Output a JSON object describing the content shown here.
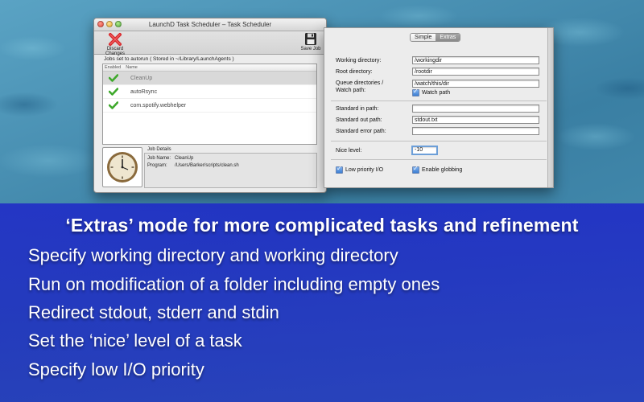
{
  "main_window": {
    "title": "LaunchD Task Scheduler – Task Scheduler",
    "toolbar": {
      "discard_label": "Discard Changes",
      "discard_icon": "red-x-icon",
      "save_label": "Save Job",
      "save_icon": "floppy-disk-icon"
    },
    "jobs_label": "Jobs set to autorun ( Stored in ~/Library/LaunchAgents )",
    "columns": [
      "Enabled",
      "Name"
    ],
    "jobs": [
      {
        "enabled": true,
        "name": "CleanUp",
        "selected": true
      },
      {
        "enabled": true,
        "name": "autoRsync",
        "selected": false
      },
      {
        "enabled": true,
        "name": "com.spotify.webhelper",
        "selected": false
      }
    ],
    "details": {
      "label": "Job Details",
      "job_name_label": "Job Name:",
      "job_name": "CleanUp",
      "program_label": "Program:",
      "program": "/Users/Barker/scripts/clean.sh"
    }
  },
  "extras_window": {
    "tabs": [
      {
        "label": "Simple",
        "selected": false
      },
      {
        "label": "Extras",
        "selected": true
      }
    ],
    "fields": {
      "working_directory": {
        "label": "Working directory:",
        "value": "/workingdir"
      },
      "root_directory": {
        "label": "Root directory:",
        "value": "/rootdir"
      },
      "queue_directories": {
        "label": "Queue directories /",
        "label2": "Watch path:",
        "value": "/watch/this/dir"
      },
      "watch_path_checkbox": {
        "label": "Watch path",
        "checked": true
      },
      "standard_in": {
        "label": "Standard in path:",
        "value": ""
      },
      "standard_out": {
        "label": "Standard out path:",
        "value": "stdout.txt"
      },
      "standard_error": {
        "label": "Standard error path:",
        "value": ""
      },
      "nice_level": {
        "label": "Nice level:",
        "value": "-10"
      },
      "low_priority_io": {
        "label": "Low priority I/O",
        "checked": true
      },
      "enable_globbing": {
        "label": "Enable globbing",
        "checked": true
      }
    }
  },
  "caption": {
    "title": "‘Extras’ mode for more complicated tasks and refinement",
    "lines": [
      "Specify working directory and working directory",
      "Run on modification of a folder including empty ones",
      "Redirect stdout, stderr and stdin",
      "Set the ‘nice’ level of a task",
      "Specify low I/O priority"
    ]
  },
  "colors": {
    "caption_band": "#2a30c8",
    "background": "#3f86a8",
    "check_green": "#3fa92c",
    "discard_red": "#d8262a"
  }
}
